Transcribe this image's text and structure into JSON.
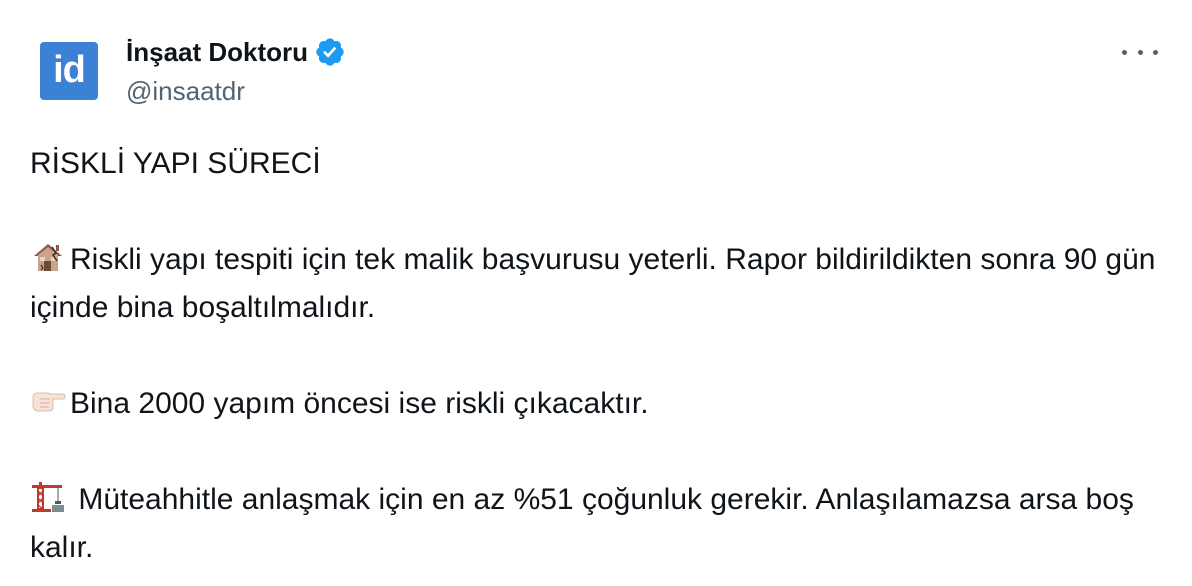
{
  "author": {
    "avatar_text": "id",
    "name": "İnşaat Doktoru",
    "handle": "@insaatdr",
    "verified": true
  },
  "menu": {
    "icon": "more-horizontal-icon"
  },
  "tweet": {
    "heading": "RİSKLİ YAPI SÜRECİ",
    "paragraph1_emoji": "derelict-house-emoji",
    "paragraph1": "Riskli yapı tespiti için tek malik başvurusu yeterli. Rapor bildirildikten sonra 90 gün içinde bina boşaltılmalıdır.",
    "paragraph2_emoji": "pointing-right-emoji",
    "paragraph2": "Bina 2000 yapım öncesi ise riskli çıkacaktır.",
    "paragraph3_emoji": "construction-crane-emoji",
    "paragraph3": " Müteahhitle anlaşmak için en az %51 çoğunluk gerekir. Anlaşılamazsa arsa boş kalır."
  },
  "colors": {
    "avatar_bg": "#3b82d6",
    "verified_blue": "#1d9bf0",
    "text_primary": "#0f1419",
    "text_secondary": "#536471"
  }
}
